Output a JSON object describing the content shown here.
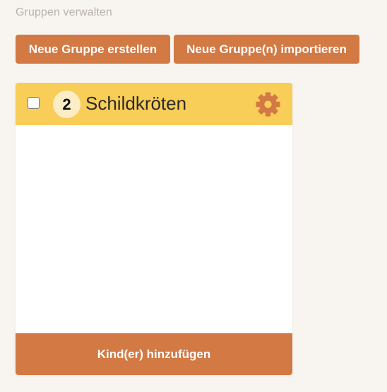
{
  "page": {
    "title": "Gruppen verwalten"
  },
  "toolbar": {
    "new_group_label": "Neue Gruppe erstellen",
    "import_group_label": "Neue Gruppe(n) importieren"
  },
  "group": {
    "checked": false,
    "count": "2",
    "name": "Schildkröten",
    "settings_icon": "gear-icon",
    "add_children_label": "Kind(er) hinzufügen"
  },
  "colors": {
    "background": "#f8f4f0",
    "accent": "#d27944",
    "header": "#f8cd58",
    "badge": "#fcedc5",
    "muted_text": "#b9b2ab"
  }
}
